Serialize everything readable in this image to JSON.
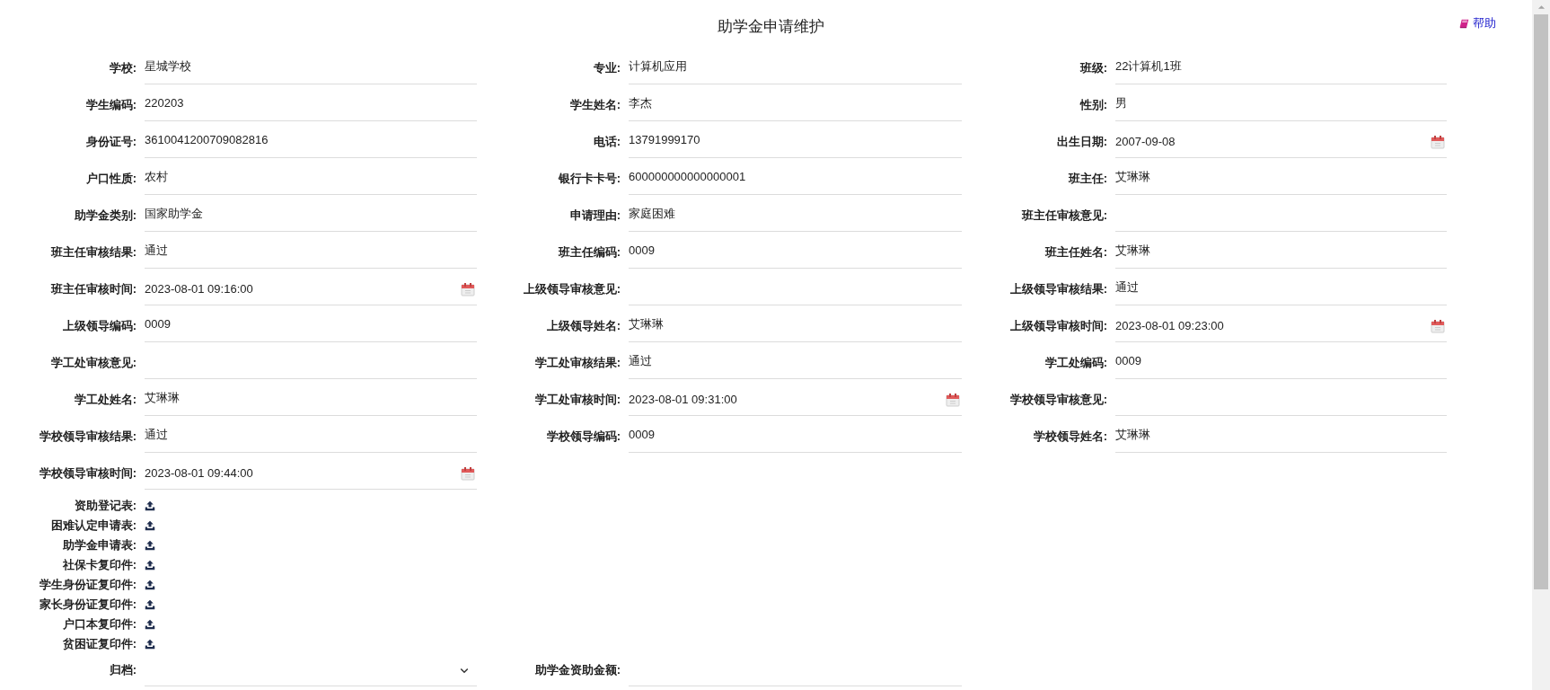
{
  "page": {
    "title": "助学金申请维护",
    "help_link": "帮助"
  },
  "fields": [
    {
      "label": "学校:",
      "value": "星城学校",
      "kind": "text"
    },
    {
      "label": "专业:",
      "value": "计算机应用",
      "kind": "text"
    },
    {
      "label": "班级:",
      "value": "22计算机1班",
      "kind": "text"
    },
    {
      "label": "学生编码:",
      "value": "220203",
      "kind": "text"
    },
    {
      "label": "学生姓名:",
      "value": "李杰",
      "kind": "text"
    },
    {
      "label": "性别:",
      "value": "男",
      "kind": "text"
    },
    {
      "label": "身份证号:",
      "value": "3610041200709082816",
      "kind": "text"
    },
    {
      "label": "电话:",
      "value": "13791999170",
      "kind": "text"
    },
    {
      "label": "出生日期:",
      "value": "2007-09-08",
      "kind": "date"
    },
    {
      "label": "户口性质:",
      "value": "农村",
      "kind": "text"
    },
    {
      "label": "银行卡卡号:",
      "value": "600000000000000001",
      "kind": "text"
    },
    {
      "label": "班主任:",
      "value": "艾琳琳",
      "kind": "text"
    },
    {
      "label": "助学金类别:",
      "value": "国家助学金",
      "kind": "text"
    },
    {
      "label": "申请理由:",
      "value": "家庭困难",
      "kind": "text"
    },
    {
      "label": "班主任审核意见:",
      "kind": "text"
    },
    {
      "label": "班主任审核结果:",
      "value": "通过",
      "kind": "text"
    },
    {
      "label": "班主任编码:",
      "value": "0009",
      "kind": "text"
    },
    {
      "label": "班主任姓名:",
      "value": "艾琳琳",
      "kind": "text"
    },
    {
      "label": "班主任审核时间:",
      "value": "2023-08-01 09:16:00",
      "kind": "date"
    },
    {
      "label": "上级领导审核意见:",
      "kind": "text"
    },
    {
      "label": "上级领导审核结果:",
      "value": "通过",
      "kind": "text"
    },
    {
      "label": "上级领导编码:",
      "value": "0009",
      "kind": "text"
    },
    {
      "label": "上级领导姓名:",
      "value": "艾琳琳",
      "kind": "text"
    },
    {
      "label": "上级领导审核时间:",
      "value": "2023-08-01 09:23:00",
      "kind": "date"
    },
    {
      "label": "学工处审核意见:",
      "kind": "text"
    },
    {
      "label": "学工处审核结果:",
      "value": "通过",
      "kind": "text"
    },
    {
      "label": "学工处编码:",
      "value": "0009",
      "kind": "text"
    },
    {
      "label": "学工处姓名:",
      "value": "艾琳琳",
      "kind": "text"
    },
    {
      "label": "学工处审核时间:",
      "value": "2023-08-01 09:31:00",
      "kind": "date"
    },
    {
      "label": "学校领导审核意见:",
      "kind": "text"
    },
    {
      "label": "学校领导审核结果:",
      "value": "通过",
      "kind": "text"
    },
    {
      "label": "学校领导编码:",
      "value": "0009",
      "kind": "text"
    },
    {
      "label": "学校领导姓名:",
      "value": "艾琳琳",
      "kind": "text"
    },
    {
      "label": "学校领导审核时间:",
      "value": "2023-08-01 09:44:00",
      "kind": "date"
    }
  ],
  "attachments": [
    {
      "label": "资助登记表:"
    },
    {
      "label": "困难认定申请表:"
    },
    {
      "label": "助学金申请表:"
    },
    {
      "label": "社保卡复印件:"
    },
    {
      "label": "学生身份证复印件:"
    },
    {
      "label": "家长身份证复印件:"
    },
    {
      "label": "户口本复印件:"
    },
    {
      "label": "贫困证复印件:"
    }
  ],
  "bottom_fields": [
    {
      "label": "归档:",
      "kind": "select"
    },
    {
      "label": "助学金资助金额:",
      "kind": "text"
    }
  ]
}
